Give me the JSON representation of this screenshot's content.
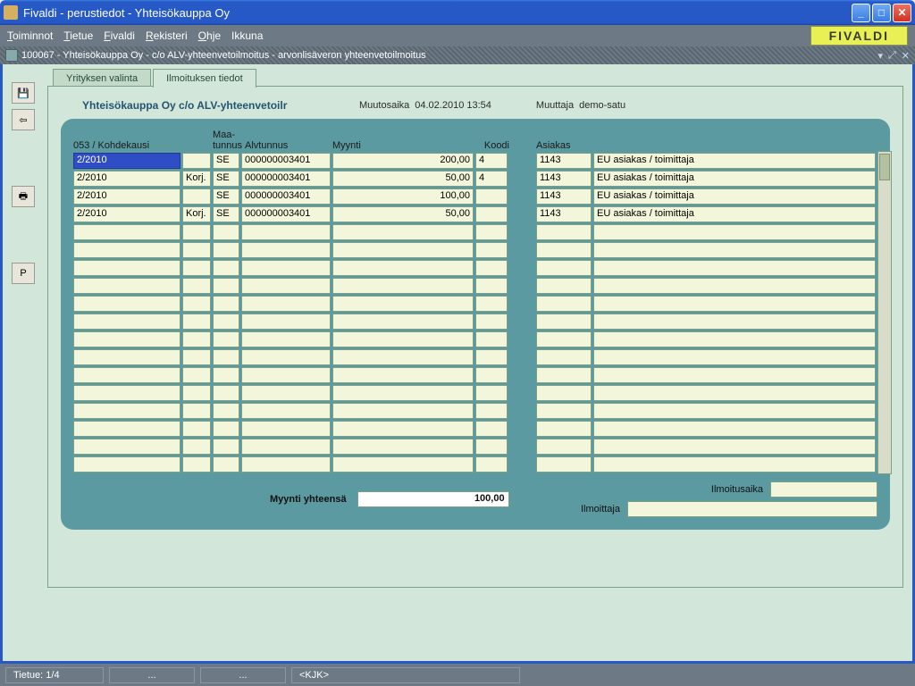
{
  "window": {
    "title": "Fivaldi - perustiedot - Yhteisökauppa Oy"
  },
  "menubar": {
    "items": [
      "Toiminnot",
      "Tietue",
      "Fivaldi",
      "Rekisteri",
      "Ohje",
      "Ikkuna"
    ],
    "brand": "FIVALDI"
  },
  "subbar": {
    "text": "100067 - Yhteisökauppa Oy - c/o ALV-yhteenvetoilmoitus - arvonlisäveron yhteenvetoilmoitus"
  },
  "left_toolbar": {
    "save": "💾",
    "back": "⇦",
    "print": "🖶",
    "p": "P"
  },
  "tabs": {
    "tab1": "Yrityksen valinta",
    "tab2": "Ilmoituksen tiedot"
  },
  "header": {
    "company": "Yhteisökauppa Oy c/o ALV-yhteenvetoilr",
    "muutosaika_lbl": "Muutosaika",
    "muutosaika_val": "04.02.2010 13:54",
    "muuttaja_lbl": "Muuttaja",
    "muuttaja_val": "demo-satu"
  },
  "grid_headers": {
    "kohdekausi": "053 / Kohdekausi",
    "maa1": "Maa-",
    "maa2": "tunnus",
    "alvtunnus": "Alvtunnus",
    "myynti": "Myynti",
    "koodi": "Koodi",
    "asiakas": "Asiakas"
  },
  "rows_left": [
    {
      "kohde": "2/2010",
      "korj": "",
      "maa": "SE",
      "alv": "000000003401",
      "myynti": "200,00",
      "koodi": "4",
      "selected": true
    },
    {
      "kohde": "2/2010",
      "korj": "Korj.",
      "maa": "SE",
      "alv": "000000003401",
      "myynti": "50,00",
      "koodi": "4"
    },
    {
      "kohde": "2/2010",
      "korj": "",
      "maa": "SE",
      "alv": "000000003401",
      "myynti": "100,00",
      "koodi": ""
    },
    {
      "kohde": "2/2010",
      "korj": "Korj.",
      "maa": "SE",
      "alv": "000000003401",
      "myynti": "50,00",
      "koodi": ""
    }
  ],
  "rows_right": [
    {
      "num": "1143",
      "name": "EU asiakas / toimittaja"
    },
    {
      "num": "1143",
      "name": "EU asiakas / toimittaja"
    },
    {
      "num": "1143",
      "name": "EU asiakas / toimittaja"
    },
    {
      "num": "1143",
      "name": "EU asiakas / toimittaja"
    }
  ],
  "footer": {
    "total_lbl": "Myynti yhteensä",
    "total_val": "100,00",
    "ilmoitusaika_lbl": "Ilmoitusaika",
    "ilmoittaja_lbl": "Ilmoittaja"
  },
  "statusbar": {
    "record": "Tietue: 1/4",
    "dots1": "...",
    "dots2": "...",
    "mode": "<KJK>"
  }
}
